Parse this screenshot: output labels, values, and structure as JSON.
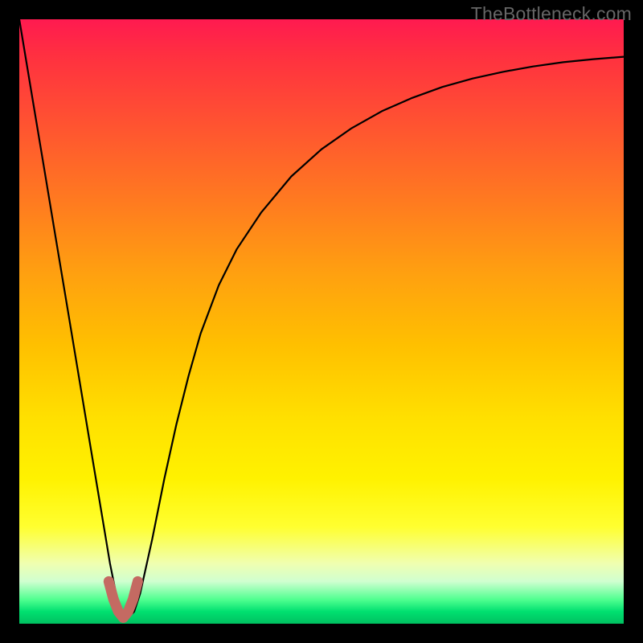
{
  "watermark": "TheBottleneck.com",
  "chart_data": {
    "type": "line",
    "title": "",
    "xlabel": "",
    "ylabel": "",
    "x_range": [
      0,
      100
    ],
    "y_range": [
      0,
      100
    ],
    "series": [
      {
        "name": "curve",
        "x": [
          0,
          2,
          4,
          6,
          8,
          10,
          12,
          14,
          15,
          16,
          17,
          18,
          19,
          20,
          22,
          24,
          26,
          28,
          30,
          33,
          36,
          40,
          45,
          50,
          55,
          60,
          65,
          70,
          75,
          80,
          85,
          90,
          95,
          100
        ],
        "values": [
          100,
          88,
          76,
          64,
          52,
          40,
          28,
          16,
          10,
          5,
          2,
          1,
          2,
          5,
          14,
          24,
          33,
          41,
          48,
          56,
          62,
          68,
          74,
          78.5,
          82,
          84.8,
          87,
          88.8,
          90.2,
          91.3,
          92.2,
          92.9,
          93.4,
          93.8
        ]
      },
      {
        "name": "valley-highlight",
        "x": [
          14.8,
          15.6,
          16.4,
          17.2,
          18.0,
          18.8,
          19.6
        ],
        "values": [
          7.0,
          4.0,
          2.0,
          1.0,
          2.0,
          4.0,
          7.0
        ]
      }
    ],
    "colors": {
      "curve": "#000000",
      "valley": "#c46a62",
      "gradient_top": "#ff1a50",
      "gradient_bottom": "#00c060"
    }
  }
}
